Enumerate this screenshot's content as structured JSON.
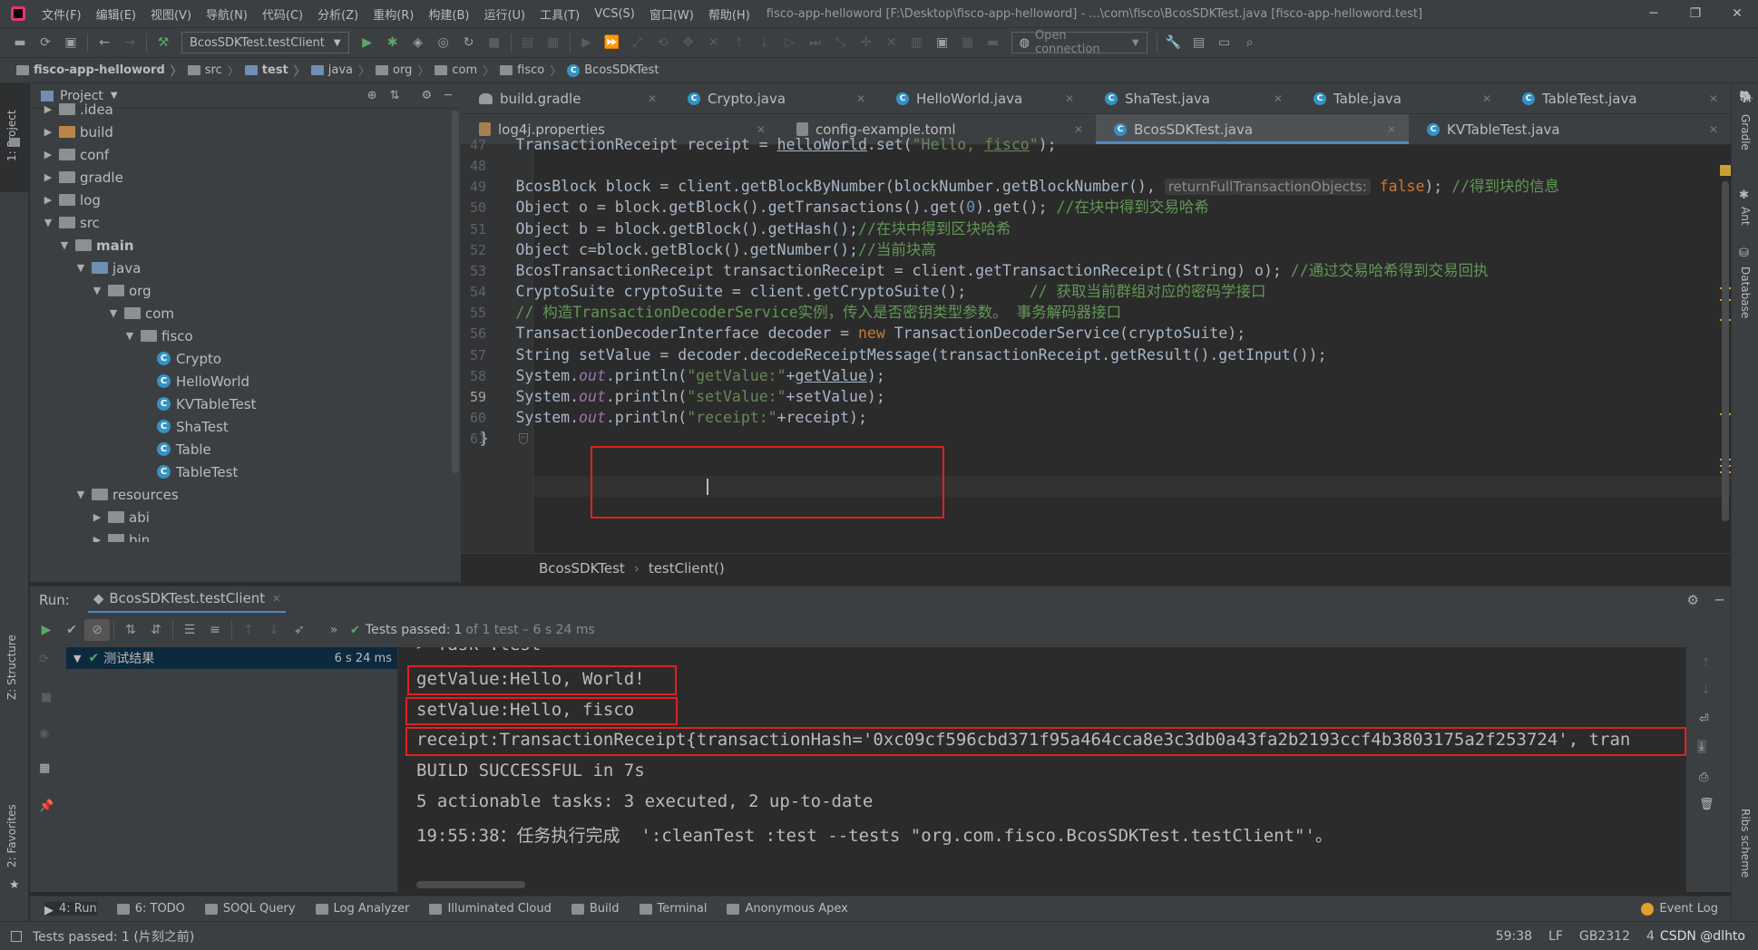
{
  "menu": [
    "文件(F)",
    "编辑(E)",
    "视图(V)",
    "导航(N)",
    "代码(C)",
    "分析(Z)",
    "重构(R)",
    "构建(B)",
    "运行(U)",
    "工具(T)",
    "VCS(S)",
    "窗口(W)",
    "帮助(H)"
  ],
  "window_title": "fisco-app-helloword [F:\\Desktop\\fisco-app-helloword] - ...\\com\\fisco\\BcosSDKTest.java [fisco-app-helloword.test]",
  "toolbar": {
    "run_config": "BcosSDKTest.testClient",
    "open_connection": "Open connection"
  },
  "breadcrumb": [
    "fisco-app-helloword",
    "src",
    "test",
    "java",
    "org",
    "com",
    "fisco",
    "BcosSDKTest"
  ],
  "project": {
    "title": "Project",
    "tree": [
      {
        "label": ".idea",
        "depth": 1,
        "arrow": "▶",
        "kind": "folder"
      },
      {
        "label": "build",
        "depth": 1,
        "arrow": "▶",
        "kind": "folder-orange"
      },
      {
        "label": "conf",
        "depth": 1,
        "arrow": "▶",
        "kind": "folder"
      },
      {
        "label": "gradle",
        "depth": 1,
        "arrow": "▶",
        "kind": "folder"
      },
      {
        "label": "log",
        "depth": 1,
        "arrow": "▶",
        "kind": "folder"
      },
      {
        "label": "src",
        "depth": 1,
        "arrow": "▼",
        "kind": "folder"
      },
      {
        "label": "main",
        "depth": 2,
        "arrow": "▼",
        "kind": "folder",
        "bold": true
      },
      {
        "label": "java",
        "depth": 3,
        "arrow": "▼",
        "kind": "folder-blue"
      },
      {
        "label": "org",
        "depth": 4,
        "arrow": "▼",
        "kind": "folder"
      },
      {
        "label": "com",
        "depth": 5,
        "arrow": "▼",
        "kind": "folder"
      },
      {
        "label": "fisco",
        "depth": 6,
        "arrow": "▼",
        "kind": "folder"
      },
      {
        "label": "Crypto",
        "depth": 7,
        "arrow": "",
        "kind": "class"
      },
      {
        "label": "HelloWorld",
        "depth": 7,
        "arrow": "",
        "kind": "class"
      },
      {
        "label": "KVTableTest",
        "depth": 7,
        "arrow": "",
        "kind": "class"
      },
      {
        "label": "ShaTest",
        "depth": 7,
        "arrow": "",
        "kind": "class"
      },
      {
        "label": "Table",
        "depth": 7,
        "arrow": "",
        "kind": "class"
      },
      {
        "label": "TableTest",
        "depth": 7,
        "arrow": "",
        "kind": "class"
      },
      {
        "label": "resources",
        "depth": 3,
        "arrow": "▼",
        "kind": "folder"
      },
      {
        "label": "abi",
        "depth": 4,
        "arrow": "▶",
        "kind": "folder"
      },
      {
        "label": "bin",
        "depth": 4,
        "arrow": "▶",
        "kind": "folder"
      }
    ]
  },
  "tabs_row1": [
    {
      "label": "build.gradle",
      "icon": "gradle"
    },
    {
      "label": "Crypto.java",
      "icon": "class"
    },
    {
      "label": "HelloWorld.java",
      "icon": "class"
    },
    {
      "label": "ShaTest.java",
      "icon": "class"
    },
    {
      "label": "Table.java",
      "icon": "class"
    },
    {
      "label": "TableTest.java",
      "icon": "class"
    }
  ],
  "tabs_row2": [
    {
      "label": "log4j.properties",
      "icon": "prop"
    },
    {
      "label": "config-example.toml",
      "icon": "toml"
    },
    {
      "label": "BcosSDKTest.java",
      "icon": "class",
      "active": true
    },
    {
      "label": "KVTableTest.java",
      "icon": "class"
    }
  ],
  "editor": {
    "line_numbers": [
      "47",
      "48",
      "49",
      "50",
      "51",
      "52",
      "53",
      "54",
      "55",
      "56",
      "57",
      "58",
      "59",
      "60",
      "61"
    ],
    "current_line": "59",
    "crumb": [
      "BcosSDKTest",
      "testClient()"
    ]
  },
  "run": {
    "label": "Run:",
    "config": "BcosSDKTest.testClient",
    "tests_passed_prefix": "Tests passed:",
    "tests_passed_count": "1",
    "tests_passed_suffix": "of 1 test – 6 s 24 ms",
    "tree_root": "测试结果",
    "tree_time": "6 s 24 ms",
    "console": [
      "> Task :test",
      "getValue:Hello, World!",
      "setValue:Hello, fisco",
      "receipt:TransactionReceipt{transactionHash='0xc09cf596cbd371f95a464cca8e3c3db0a43fa2b2193ccf4b3803175a2f253724', tran",
      "BUILD SUCCESSFUL in 7s",
      "5 actionable tasks: 3 executed, 2 up-to-date",
      "19:55:38：任务执行完成  ':cleanTest :test --tests \"org.com.fisco.BcosSDKTest.testClient\"'。"
    ]
  },
  "bottom_tools": [
    "4: Run",
    "6: TODO",
    "SOQL Query",
    "Log Analyzer",
    "Illuminated Cloud",
    "Build",
    "Terminal",
    "Anonymous Apex"
  ],
  "event_log": "Event Log",
  "status": {
    "message": "Tests passed: 1 (片刻之前)",
    "position": "59:38",
    "line_sep": "LF",
    "encoding": "GB2312",
    "indent": "4",
    "watermark": "CSDN @dlhto"
  },
  "left_tabs": [
    "1: Project",
    "Z: Structure",
    "2: Favorites"
  ],
  "right_tabs": [
    "Gradle",
    "Ant",
    "Database",
    "Ribs scheme"
  ],
  "colors": {
    "accent": "#4a88c7",
    "red_box": "#e02020",
    "green": "#59a869"
  }
}
